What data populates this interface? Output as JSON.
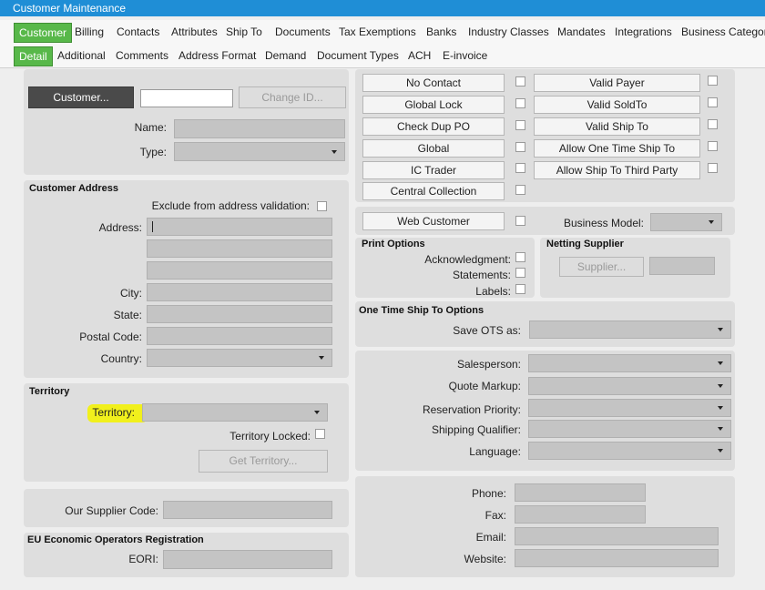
{
  "window": {
    "title": "Customer Maintenance"
  },
  "tabs_main": [
    "Customer",
    "Billing",
    "Contacts",
    "Attributes",
    "Ship To",
    "Documents",
    "Tax Exemptions",
    "Banks",
    "Industry Classes",
    "Mandates",
    "Integrations",
    "Business Categor"
  ],
  "tabs_sub": [
    "Detail",
    "Additional",
    "Comments",
    "Address Format",
    "Demand",
    "Document Types",
    "ACH",
    "E-invoice"
  ],
  "customer": {
    "customer_button": "Customer...",
    "customer_id_value": "",
    "change_id_button": "Change ID...",
    "name_label": "Name:",
    "type_label": "Type:"
  },
  "flags": {
    "left": [
      "No Contact",
      "Global Lock",
      "Check Dup PO",
      "Global",
      "IC Trader",
      "Central Collection"
    ],
    "right": [
      "Valid Payer",
      "Valid SoldTo",
      "Valid Ship To",
      "Allow One Time Ship To",
      "Allow Ship To Third Party"
    ]
  },
  "web": {
    "web_customer": "Web Customer",
    "business_model_label": "Business Model:"
  },
  "address": {
    "section": "Customer Address",
    "exclude_label": "Exclude from address validation:",
    "address_label": "Address:",
    "city_label": "City:",
    "state_label": "State:",
    "postal_label": "Postal Code:",
    "country_label": "Country:"
  },
  "print_options": {
    "section": "Print Options",
    "acknowledgment": "Acknowledgment:",
    "statements": "Statements:",
    "labels": "Labels:"
  },
  "netting": {
    "section": "Netting Supplier",
    "supplier_button": "Supplier..."
  },
  "ots": {
    "section": "One Time Ship To Options",
    "save_label": "Save OTS as:"
  },
  "misc": {
    "salesperson": "Salesperson:",
    "quote_markup": "Quote Markup:",
    "reservation_priority": "Reservation Priority:",
    "shipping_qualifier": "Shipping Qualifier:",
    "language": "Language:"
  },
  "territory": {
    "section": "Territory",
    "territory_label": "Territory:",
    "locked_label": "Territory Locked:",
    "get_button": "Get Territory..."
  },
  "supplier_code": {
    "label": "Our Supplier Code:"
  },
  "contact": {
    "phone": "Phone:",
    "fax": "Fax:",
    "email": "Email:",
    "website": "Website:"
  },
  "eori": {
    "section": "EU Economic Operators Registration",
    "label": "EORI:"
  },
  "colors": {
    "title_bar": "#1f8ed6",
    "active_tab": "#58b84a",
    "highlight": "#f1f01c"
  }
}
